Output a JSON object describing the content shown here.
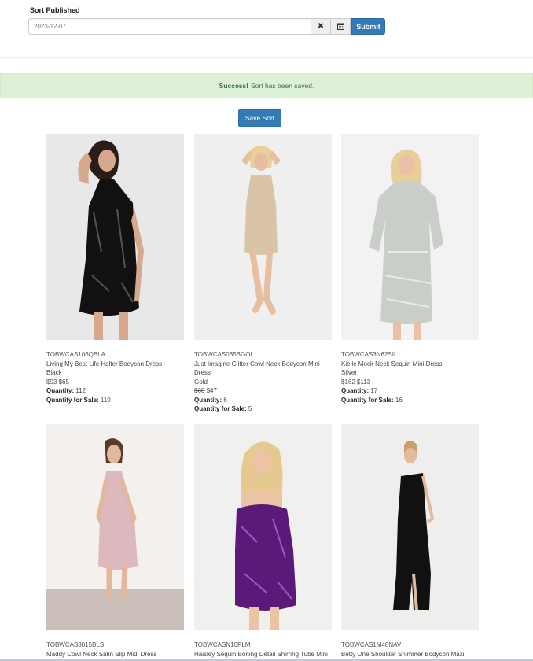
{
  "header": {
    "sort_label": "Sort Published",
    "date_value": "2023-12-07",
    "clear_icon": "close-icon",
    "calendar_icon": "calendar-icon",
    "submit_label": "Submit"
  },
  "alert": {
    "strong": "Success!",
    "message": "Sort has been saved."
  },
  "save_sort_label": "Save Sort",
  "labels": {
    "quantity": "Quantity:",
    "quantity_for_sale": "Quantity for Sale:"
  },
  "colors": {
    "primary": "#337ab7",
    "success_bg": "#dff0d8",
    "success_text": "#3c763d"
  },
  "products": [
    {
      "sku": "TOBWCAS106QBLA",
      "name": "Living My Best Life Halter Bodycon Dress",
      "color": "Black",
      "old_price": "$93",
      "price": "$65",
      "quantity": "112",
      "quantity_for_sale": "110"
    },
    {
      "sku": "TOBWCAS035BGOL",
      "name": "Just Imagine Glitter Cowl Neck Bodycon Mini Dress",
      "color": "Gold",
      "old_price": "$68",
      "price": "$47",
      "quantity": "6",
      "quantity_for_sale": "5"
    },
    {
      "sku": "TOBWCAS3N62SIL",
      "name": "Kielle Mock Neck Sequin Mini Dress",
      "color": "Silver",
      "old_price": "$162",
      "price": "$113",
      "quantity": "17",
      "quantity_for_sale": "16"
    },
    {
      "sku": "TOBWCAS3015BLS",
      "name": "Maddy Cowl Neck Satin Slip Midi Dress"
    },
    {
      "sku": "TOBWCASN10PLM",
      "name": "Haisley Sequin Boning Detail Shirring Tube Mini"
    },
    {
      "sku": "TOBWCAS1M48NAV",
      "name": "Betty One Shoulder Shimmer Bodycon Maxi"
    }
  ]
}
